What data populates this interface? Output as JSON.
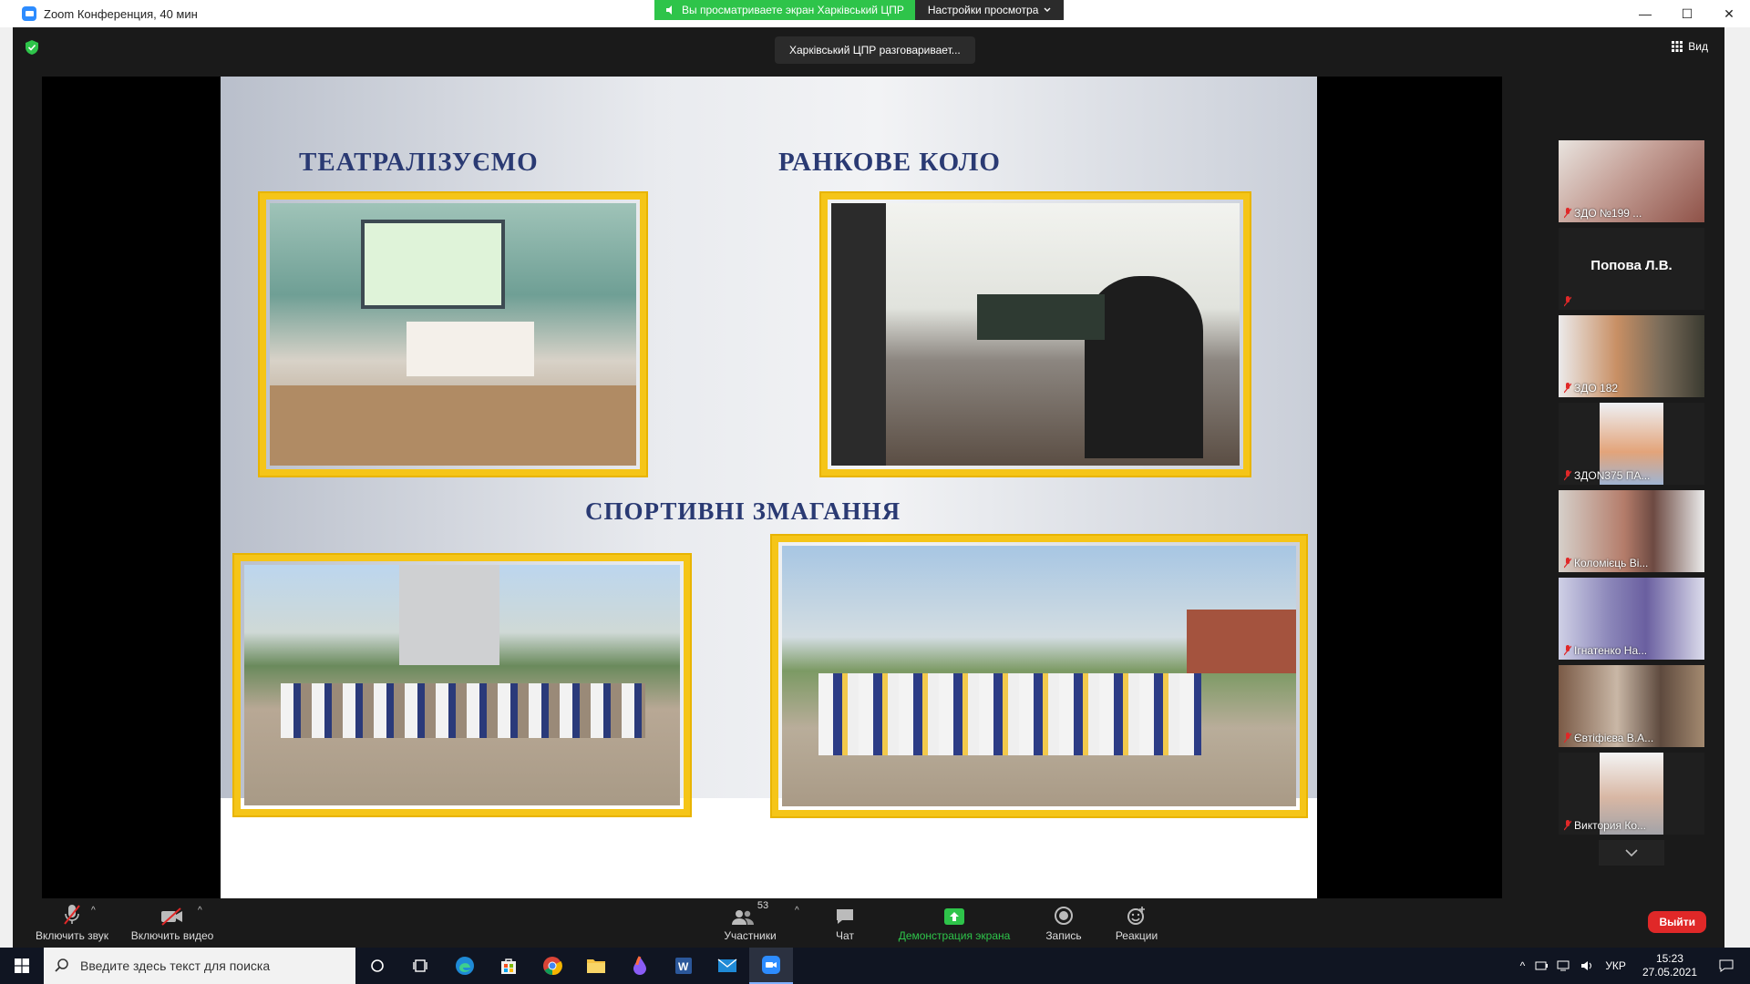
{
  "window": {
    "title": "Zoom Конференция, 40 мин",
    "minimize": "—",
    "maximize": "☐",
    "close": "✕"
  },
  "banner": {
    "sharing_text": "Вы просматриваете экран Харківський ЦПР",
    "view_options": "Настройки просмотра"
  },
  "speaker_label": "Харківський ЦПР разговаривает...",
  "view_button": "Вид",
  "slide": {
    "heading_theater": "ТЕАТРАЛІЗУЄМО",
    "heading_morning": "РАНКОВЕ КОЛО",
    "heading_sports": "СПОРТИВНІ ЗМАГАННЯ"
  },
  "gallery": [
    {
      "name": "ЗДО №199 ...",
      "type": "video"
    },
    {
      "name": "Попова Л.В.",
      "type": "name"
    },
    {
      "name": "ЗДО 182",
      "type": "video"
    },
    {
      "name": "ЗДОN375 ПА...",
      "type": "video"
    },
    {
      "name": "Коломієць Ві...",
      "type": "video"
    },
    {
      "name": "Ігнатенко На...",
      "type": "video"
    },
    {
      "name": "Євтіфієва В.А...",
      "type": "video"
    },
    {
      "name": "Виктория Ко...",
      "type": "video"
    }
  ],
  "toolbar": {
    "unmute": "Включить звук",
    "start_video": "Включить видео",
    "participants": "Участники",
    "participants_count": "53",
    "chat": "Чат",
    "share_screen": "Демонстрация экрана",
    "record": "Запись",
    "reactions": "Реакции",
    "leave": "Выйти"
  },
  "taskbar": {
    "search_placeholder": "Введите здесь текст для поиска",
    "language": "УКР",
    "time": "15:23",
    "date": "27.05.2021"
  },
  "colors": {
    "zoom_blue": "#2d8cff",
    "share_green": "#2ec44a",
    "leave_red": "#e02828",
    "frame_gold": "#f5c518",
    "heading_navy": "#2a3a73"
  }
}
